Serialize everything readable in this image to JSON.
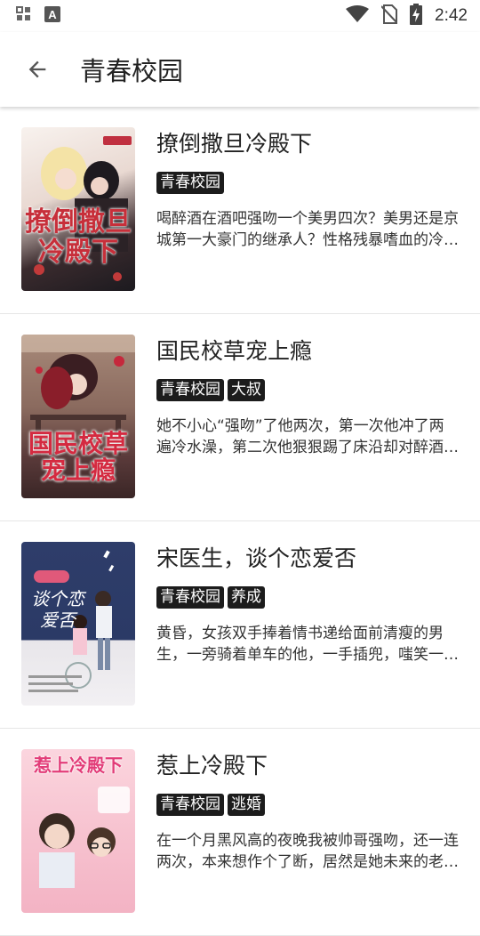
{
  "status_bar": {
    "time": "2:42",
    "left_icons": [
      "gallery-icon",
      "app-a-icon"
    ],
    "right_icons": [
      "wifi-icon",
      "no-sim-icon",
      "battery-charging-icon"
    ]
  },
  "app_bar": {
    "back_icon": "arrow-back-icon",
    "title": "青春校园"
  },
  "books": [
    {
      "title": "撩倒撒旦冷殿下",
      "tags": [
        "青春校园"
      ],
      "description": "喝醉酒在酒吧强吻一个美男四次？美男还是京城第一大豪门的继承人？性格残暴嗜血的冷殿下…",
      "cover_text": "撩倒撒旦冷殿下",
      "cover_colors": [
        "#f3e9e4",
        "#c72f3a"
      ]
    },
    {
      "title": "国民校草宠上瘾",
      "tags": [
        "青春校园",
        "大叔"
      ],
      "description": "她不小心“强吻”了他两次，第一次他冲了两遍冷水澡，第二次他狠狠踢了床沿却对醉酒的她…",
      "cover_text": "国民校草宠上瘾",
      "cover_colors": [
        "#6b4a4a",
        "#c72a3c"
      ]
    },
    {
      "title": "宋医生，谈个恋爱否",
      "tags": [
        "青春校园",
        "养成"
      ],
      "description": "黄昏，女孩双手捧着情书递给面前清瘦的男生，一旁骑着单车的他，一手插兜，嗤笑一声…",
      "cover_text": "谈个恋爱否",
      "cover_colors": [
        "#2b3a66",
        "#ffffff"
      ]
    },
    {
      "title": "惹上冷殿下",
      "tags": [
        "青春校园",
        "逃婚"
      ],
      "description": "在一个月黑风高的夜晚我被帅哥强吻，还一连两次，本来想作个了断，居然是她未来的老公…",
      "cover_text": "惹上冷殿下",
      "cover_colors": [
        "#f7c3d0",
        "#e23c78"
      ]
    }
  ]
}
